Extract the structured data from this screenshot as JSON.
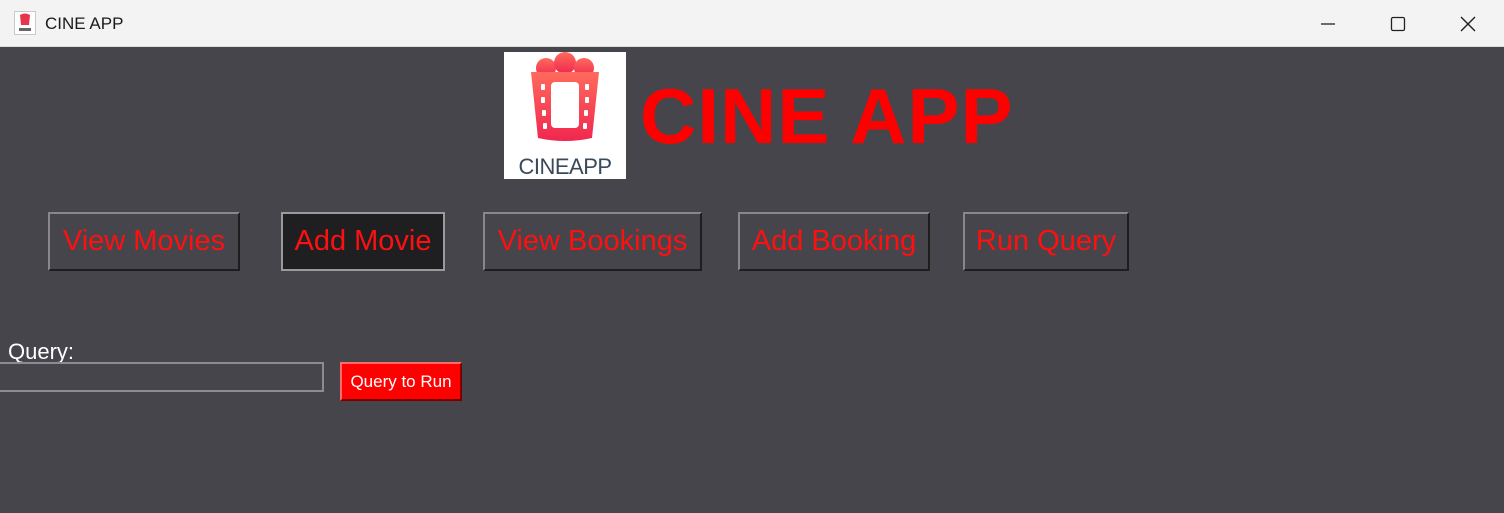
{
  "window": {
    "title": "CINE APP",
    "controls": {
      "minimize": "—",
      "maximize": "☐",
      "close": "✕"
    }
  },
  "header": {
    "logo_text": "CINEAPP",
    "title": "CINE APP"
  },
  "nav": {
    "view_movies": "View Movies",
    "add_movie": "Add Movie",
    "view_bookings": "View Bookings",
    "add_booking": "Add Booking",
    "run_query": "Run Query"
  },
  "query": {
    "label": "Query:",
    "value": "",
    "button": "Query to Run"
  },
  "colors": {
    "background": "#46454b",
    "accent": "#ff0000",
    "active_button": "#1f1f21"
  }
}
